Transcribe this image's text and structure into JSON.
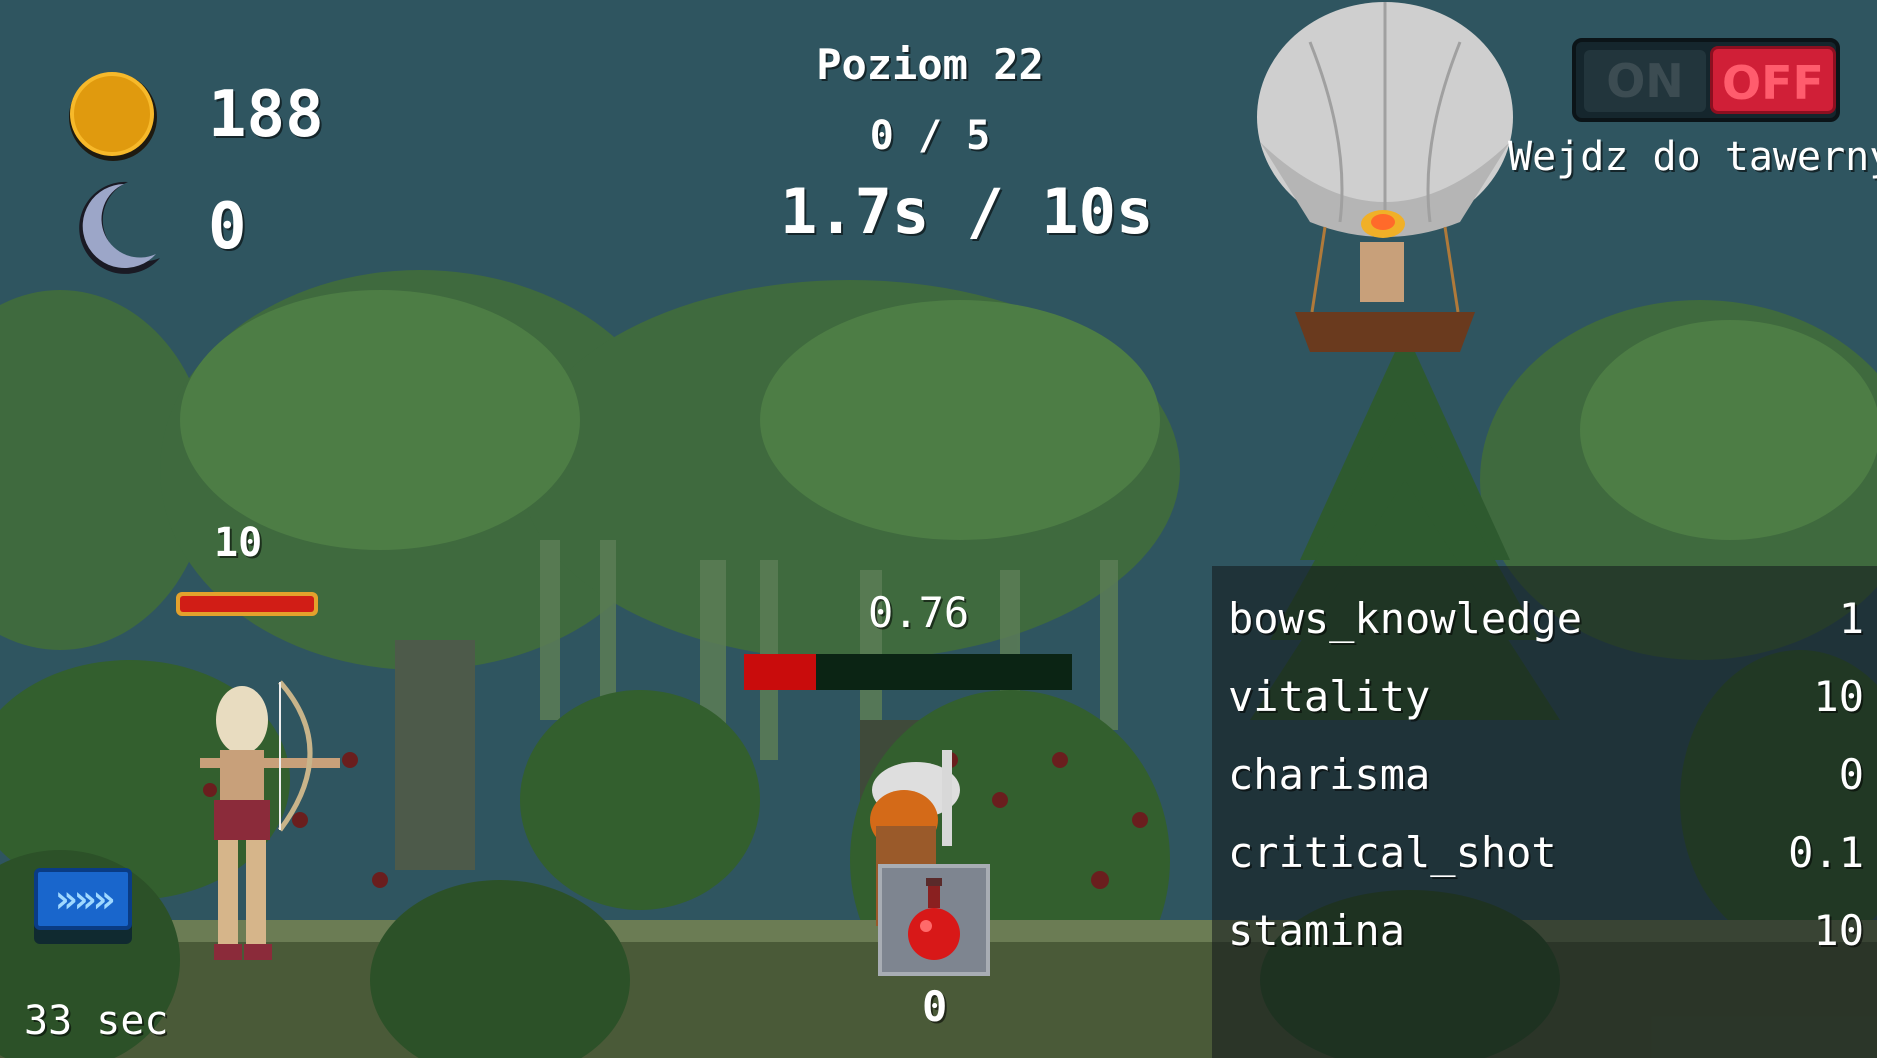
{
  "hud": {
    "coins": "188",
    "moons": "0",
    "coin_icon": "gold-coin-icon",
    "moon_icon": "crescent-moon-icon"
  },
  "level": {
    "title": "Poziom 22",
    "wave_progress": "0 / 5",
    "timer": "1.7s / 10s"
  },
  "toggle": {
    "on_label": "ON",
    "off_label": "OFF",
    "state": "OFF",
    "tavern_label": "Wejdz do tawerny"
  },
  "player": {
    "hp_label": "10",
    "hp_fraction": 1.0
  },
  "enemy": {
    "hp_value": "0.76",
    "hp_fraction": 0.22
  },
  "potion": {
    "icon": "red-potion-icon",
    "count": "0"
  },
  "speed": {
    "button_label": "»»»",
    "timer": "33 sec"
  },
  "stats": [
    {
      "name": "bows_knowledge",
      "value": "1"
    },
    {
      "name": "vitality",
      "value": "10"
    },
    {
      "name": "charisma",
      "value": "0"
    },
    {
      "name": "critical_shot",
      "value": "0.1"
    },
    {
      "name": "stamina",
      "value": "10"
    }
  ],
  "colors": {
    "sky": "#2f5560",
    "coin": "#e09a0e",
    "moon": "#9ca6c8",
    "hp_red": "#c90c0c",
    "toggle_off": "#d01f37",
    "speed_blue": "#1966cc"
  }
}
